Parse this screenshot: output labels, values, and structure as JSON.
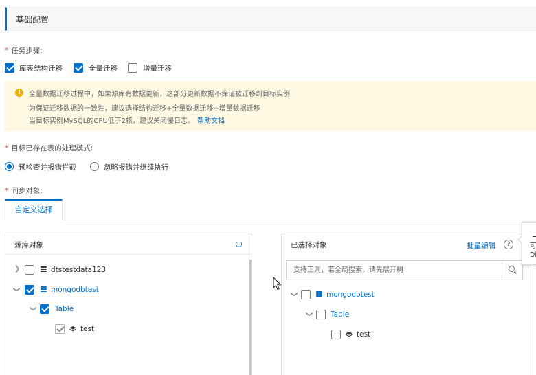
{
  "section": {
    "title": "基础配置"
  },
  "task_steps": {
    "label": "任务步骤:",
    "options": [
      {
        "label": "库表结构迁移",
        "checked": true
      },
      {
        "label": "全量迁移",
        "checked": true
      },
      {
        "label": "增量迁移",
        "checked": false
      }
    ]
  },
  "notice": {
    "lines": [
      "全量数据迁移过程中，如果源库有数据更新，这部分更新数据不保证被迁移到目标实例",
      "为保证迁移数据的一致性，建议选择结构迁移+全量数据迁移+增量数据迁移",
      "当目标实例MySQL的CPU低于2核，建议关闭慢日志。"
    ],
    "link": "帮助文档",
    "icon": "warning-icon",
    "color": "#fff8e3"
  },
  "conflict_mode": {
    "label": "目标已存在表的处理模式:",
    "options": [
      {
        "label": "预检查并报错拦截",
        "selected": true
      },
      {
        "label": "忽略报错并继续执行",
        "selected": false
      }
    ]
  },
  "sync_objects": {
    "label": "同步对象:",
    "tab": "自定义选择"
  },
  "source_panel": {
    "title": "源库对象",
    "refresh_icon": "refresh-icon",
    "tree": [
      {
        "label": "dtstestdata123",
        "checked": false,
        "expanded": false
      },
      {
        "label": "mongodbtest",
        "checked": true,
        "expanded": true
      },
      {
        "label": "Table",
        "checked": true,
        "expanded": true
      },
      {
        "label": "test",
        "checked": true
      }
    ]
  },
  "selected_panel": {
    "title": "已选择对象",
    "batch_edit": "批量编辑",
    "help_icon": "help-icon",
    "search": {
      "placeholder": "支持正则，若全局搜索，请先展开树",
      "value": ""
    },
    "tree": [
      {
        "label": "mongodbtest",
        "checked": false
      },
      {
        "label": "Table",
        "checked": false
      },
      {
        "label": "test",
        "checked": false
      }
    ]
  },
  "tooltip": {
    "line1": "可",
    "line2": "Di"
  },
  "colors": {
    "accent": "#0070cc",
    "required": "#e84a2d",
    "warning": "#f0b000"
  }
}
